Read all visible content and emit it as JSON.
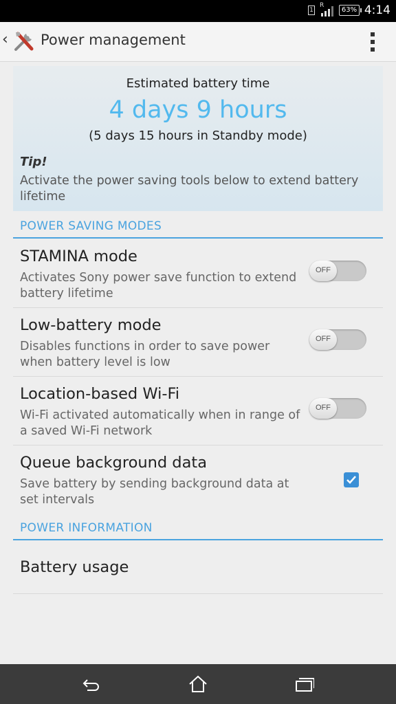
{
  "status_bar": {
    "sim_label": "1",
    "roaming_label": "R",
    "battery_percent": "63%",
    "time": "4:14"
  },
  "action_bar": {
    "back_icon": "chevron-left-icon",
    "app_icon": "tools-icon",
    "title": "Power management",
    "overflow_icon": "overflow-menu-icon"
  },
  "estimate": {
    "label": "Estimated battery time",
    "value": "4 days 9 hours",
    "standby": "(5 days 15 hours in Standby mode)",
    "tip_title": "Tip!",
    "tip_body": "Activate the power saving tools below to extend battery lifetime"
  },
  "sections": {
    "power_saving": "POWER SAVING MODES",
    "power_information": "POWER INFORMATION"
  },
  "modes": [
    {
      "title": "STAMINA mode",
      "description": "Activates Sony power save function to extend battery lifetime",
      "state": "OFF"
    },
    {
      "title": "Low-battery mode",
      "description": "Disables functions in order to save power when battery level is low",
      "state": "OFF"
    },
    {
      "title": "Location-based Wi-Fi",
      "description": "Wi-Fi activated automatically when in range of a saved Wi-Fi network",
      "state": "OFF"
    },
    {
      "title": "Queue background data",
      "description": "Save battery by sending background data at set intervals",
      "checked": true
    }
  ],
  "power_info": {
    "battery_usage": "Battery usage"
  },
  "nav_bar": {
    "back_icon": "back-icon",
    "home_icon": "home-icon",
    "recents_icon": "recent-apps-icon"
  },
  "colors": {
    "accent": "#4aa3df",
    "estimate_value": "#52b9ee",
    "checkbox": "#3a8fd6"
  }
}
